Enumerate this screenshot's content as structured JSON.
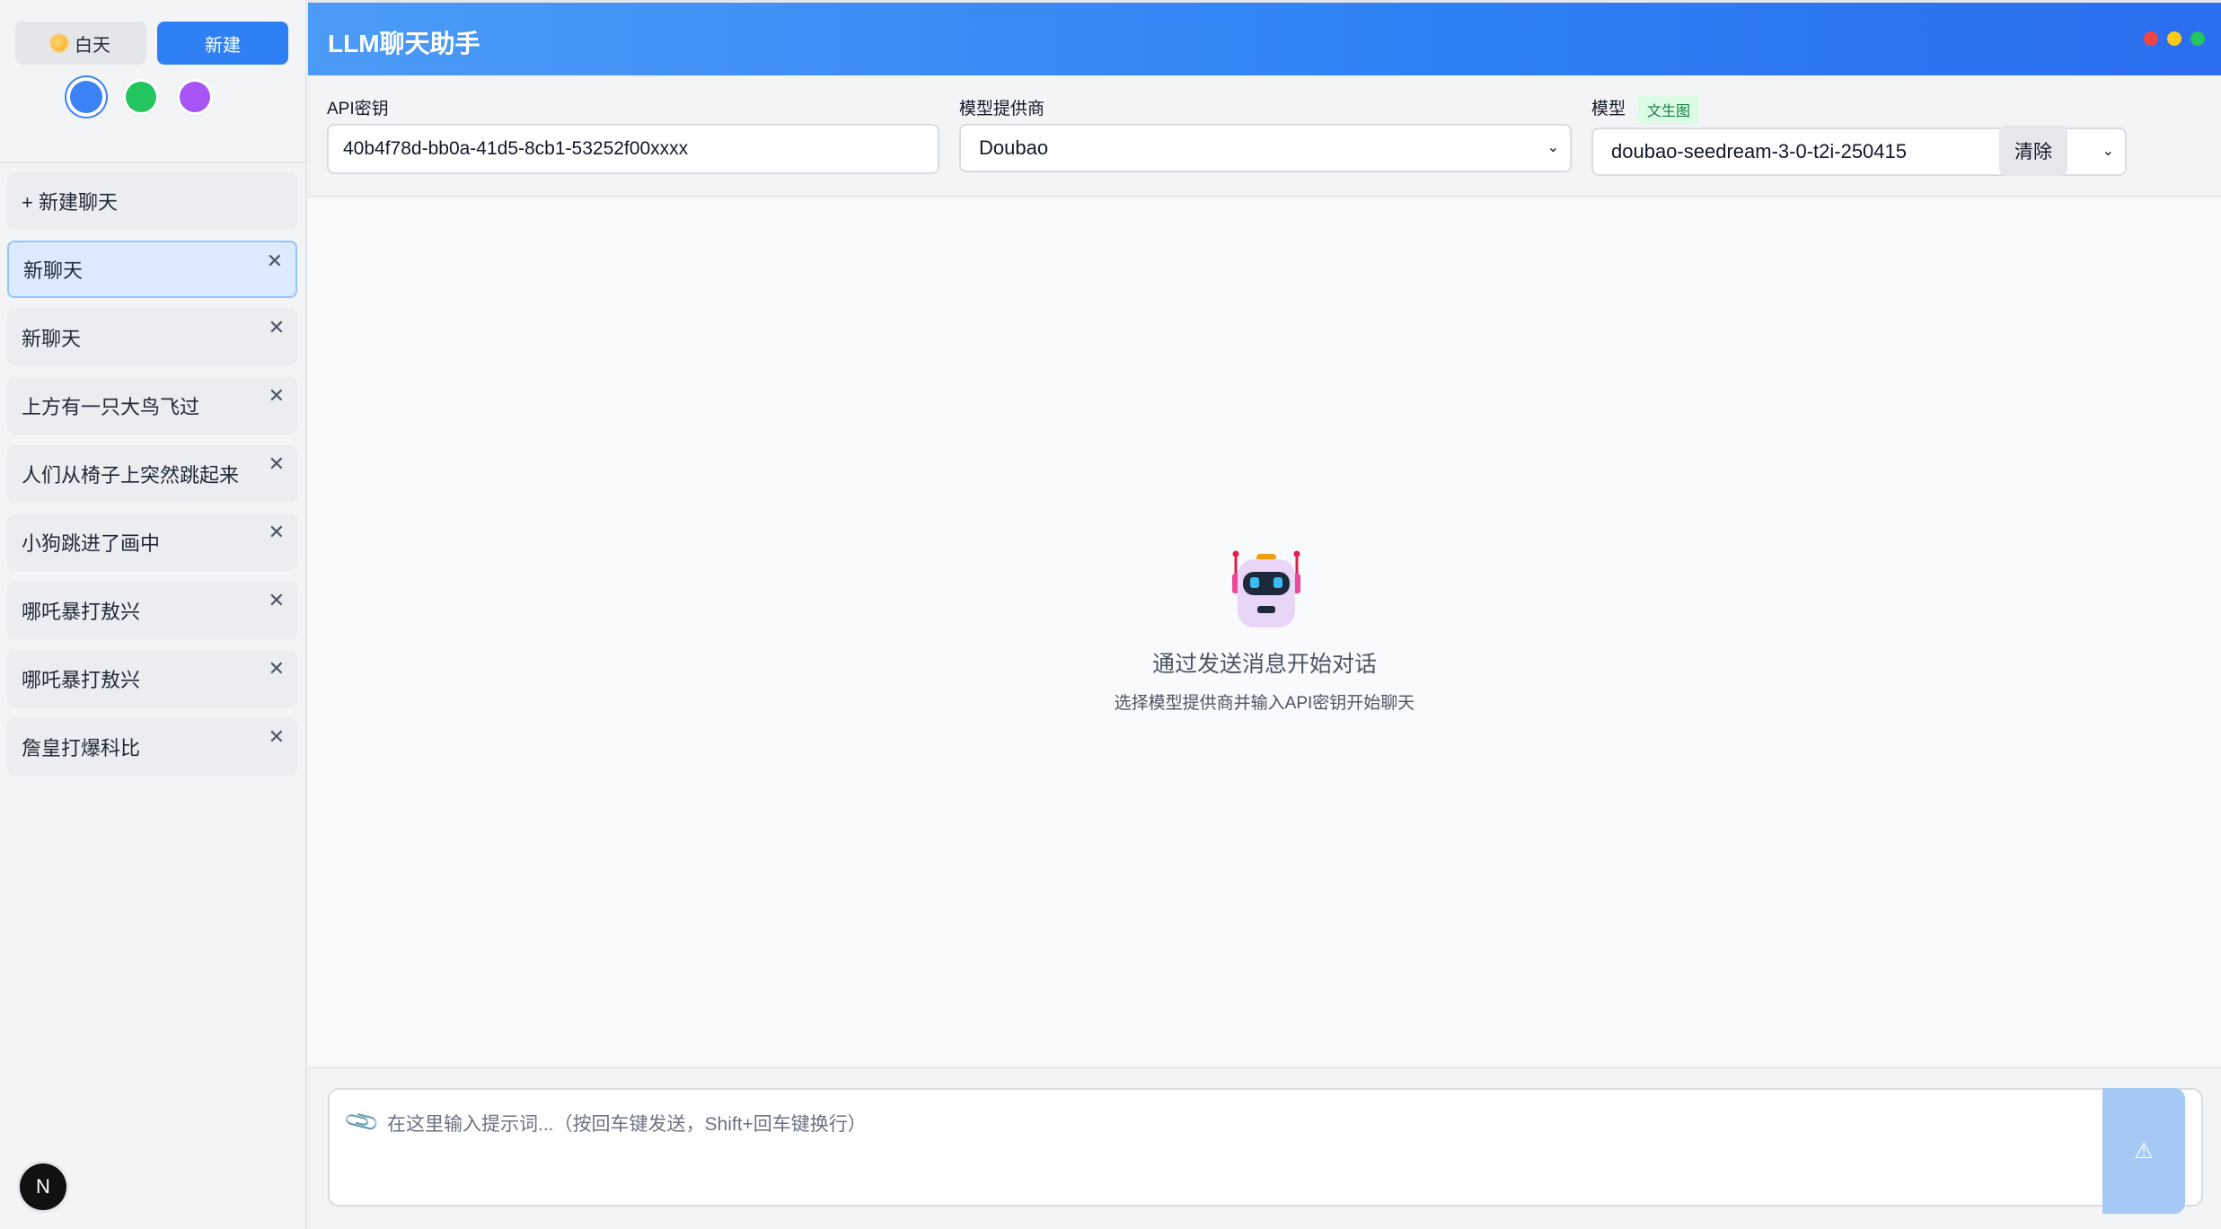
{
  "sidebar": {
    "theme_button": "白天",
    "new_button": "新建",
    "new_chat_label": "+ 新建聊天",
    "chats": [
      {
        "title": "新聊天",
        "active": true
      },
      {
        "title": "新聊天",
        "active": false
      },
      {
        "title": "上方有一只大鸟飞过",
        "active": false
      },
      {
        "title": "人们从椅子上突然跳起来",
        "active": false
      },
      {
        "title": "小狗跳进了画中",
        "active": false
      },
      {
        "title": "哪吒暴打敖兴",
        "active": false
      },
      {
        "title": "哪吒暴打敖兴",
        "active": false
      },
      {
        "title": "詹皇打爆科比",
        "active": false
      }
    ],
    "close_glyph": "✕",
    "avatar_letter": "N",
    "theme_colors": [
      "#3b82f6",
      "#22c55e",
      "#a855f7"
    ]
  },
  "header": {
    "title": "LLM聊天助手"
  },
  "settings": {
    "api_key_label": "API密钥",
    "api_key_value": "40b4f78d-bb0a-41d5-8cb1-53252f00xxxx",
    "provider_label": "模型提供商",
    "provider_value": "Doubao",
    "model_label": "模型",
    "model_tag": "文生图",
    "model_value": "doubao-seedream-3-0-t2i-250415",
    "clear_button": "清除"
  },
  "empty_state": {
    "title": "通过发送消息开始对话",
    "subtitle": "选择模型提供商并输入API密钥开始聊天"
  },
  "composer": {
    "placeholder": "在这里输入提示词...（按回车键发送，Shift+回车键换行）"
  },
  "colors": {
    "accent": "#2f80f5",
    "header_gradient_start": "#4b9bf6",
    "tag_bg": "#dcfce7",
    "tag_text": "#15803d"
  }
}
